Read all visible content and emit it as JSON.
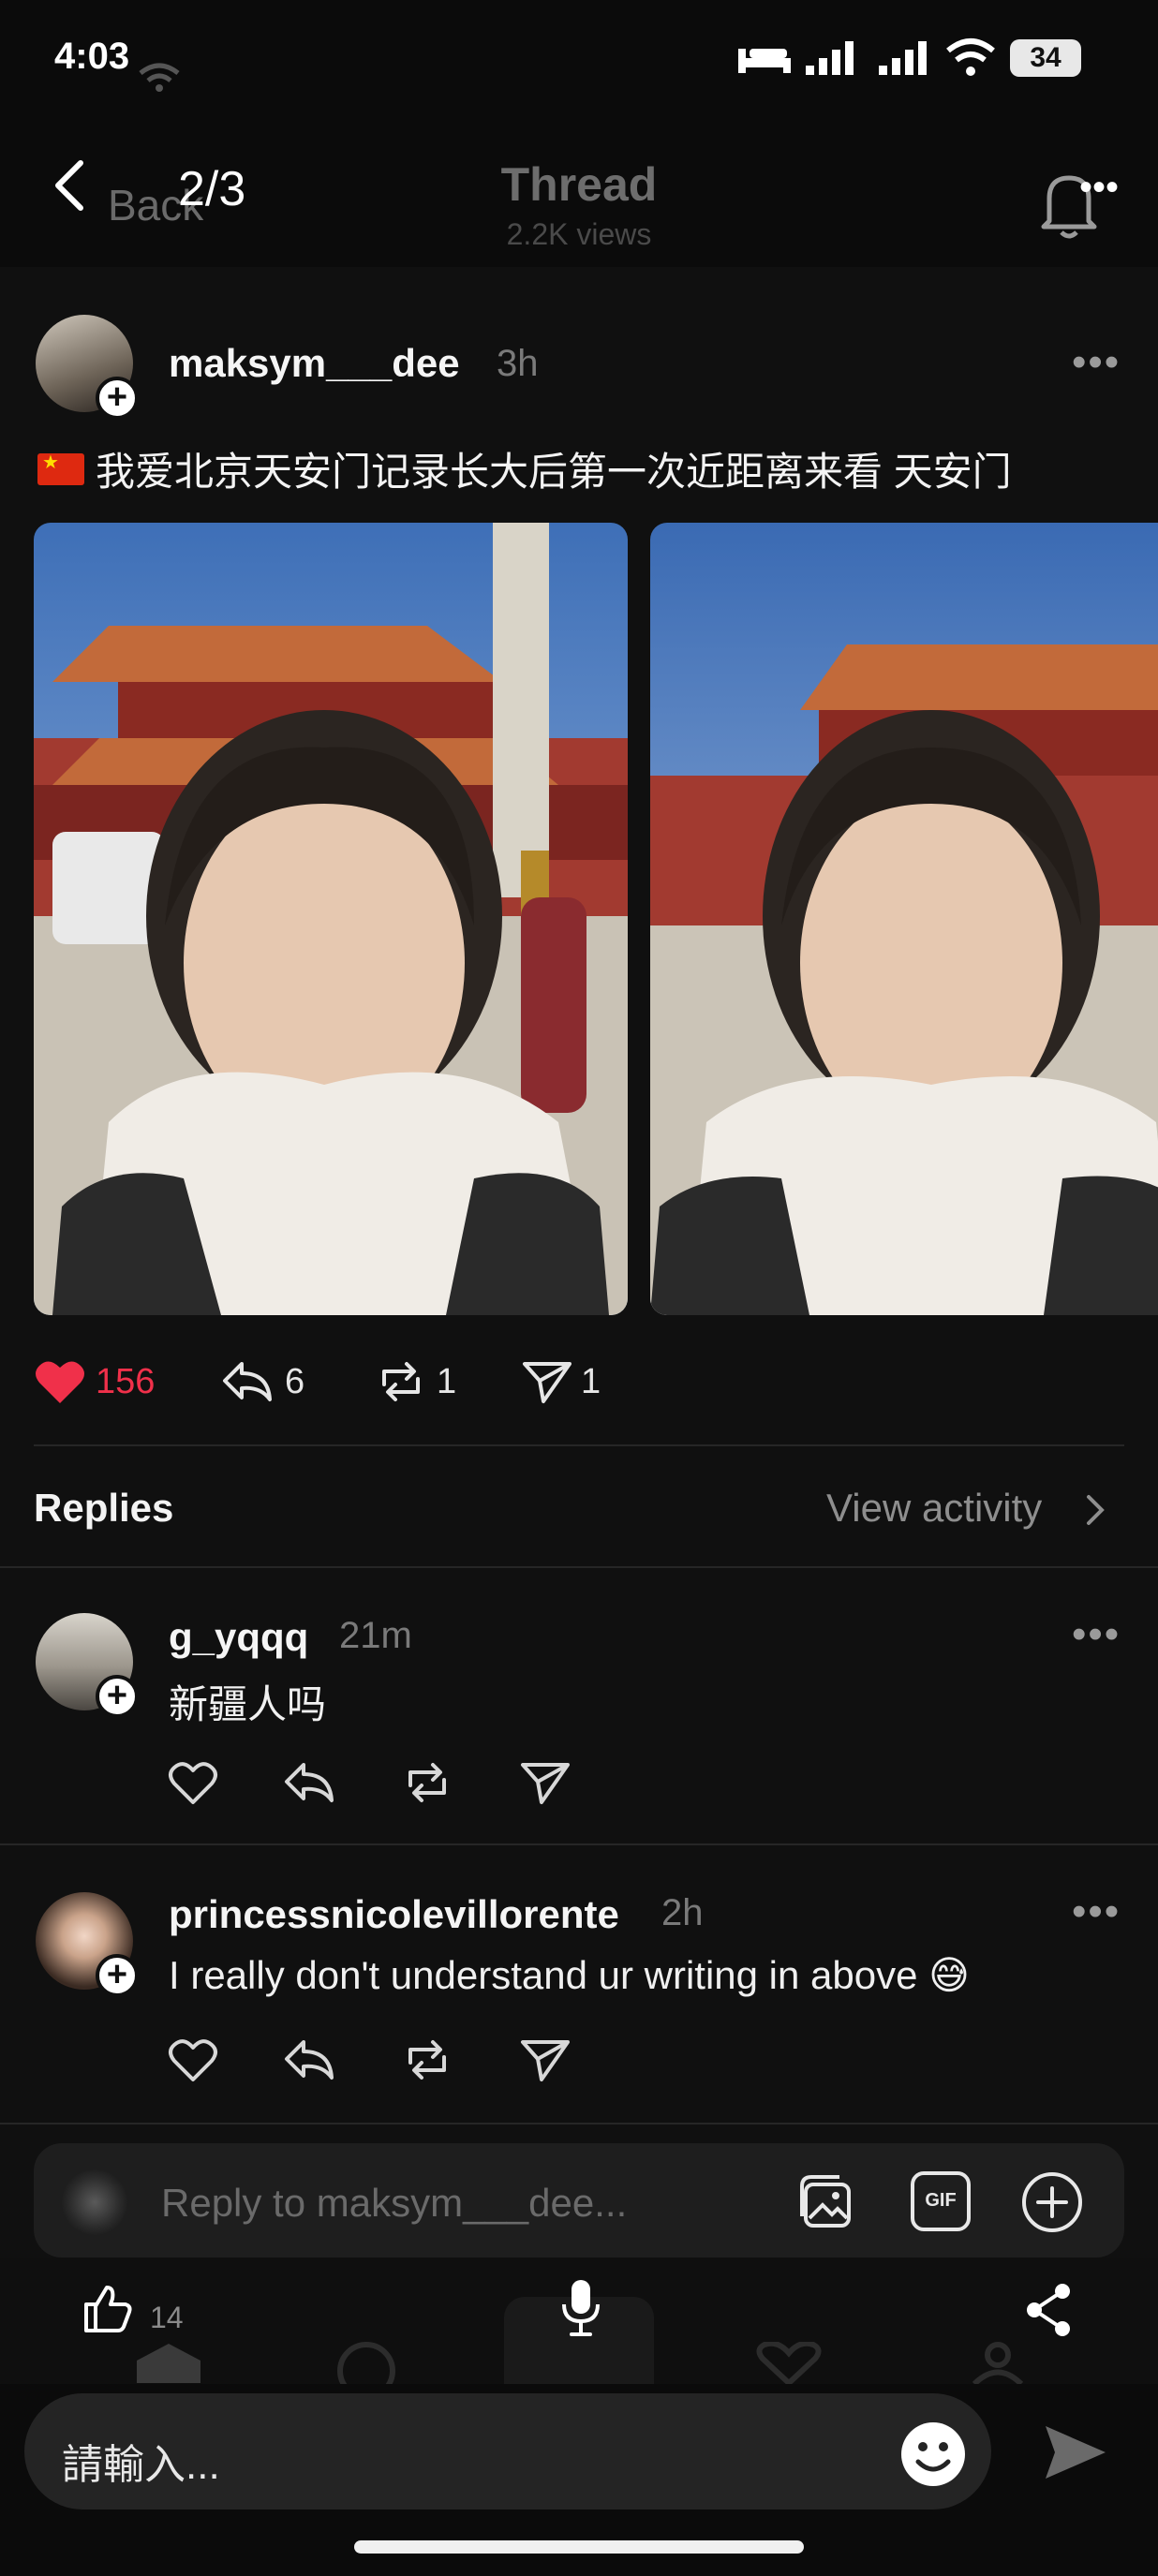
{
  "status_bar": {
    "time": "4:03",
    "battery": "34"
  },
  "header": {
    "back_label": "Back",
    "pager": "2/3",
    "title": "Thread",
    "views": "2.2K views"
  },
  "post": {
    "author": "maksym___dee",
    "time": "3h",
    "text": "我爱北京天安门记录长大后第一次近距离来看 天安门",
    "actions": {
      "likes": "156",
      "replies": "6",
      "reposts": "1",
      "shares": "1"
    }
  },
  "replies_section": {
    "title": "Replies",
    "view_activity": "View activity"
  },
  "replies": [
    {
      "author": "g_yqqq",
      "time": "21m",
      "text": "新疆人吗"
    },
    {
      "author": "princessnicolevillorente",
      "time": "2h",
      "text": "I really don't understand ur writing in above 😅"
    }
  ],
  "reply_box": {
    "placeholder": "Reply to maksym___dee...",
    "gif_label": "GIF"
  },
  "overlay": {
    "thumbs_count": "14",
    "input_placeholder": "請輸入..."
  },
  "colors": {
    "background": "#101010",
    "like_red": "#f0304a",
    "muted": "#7a7a7a"
  }
}
